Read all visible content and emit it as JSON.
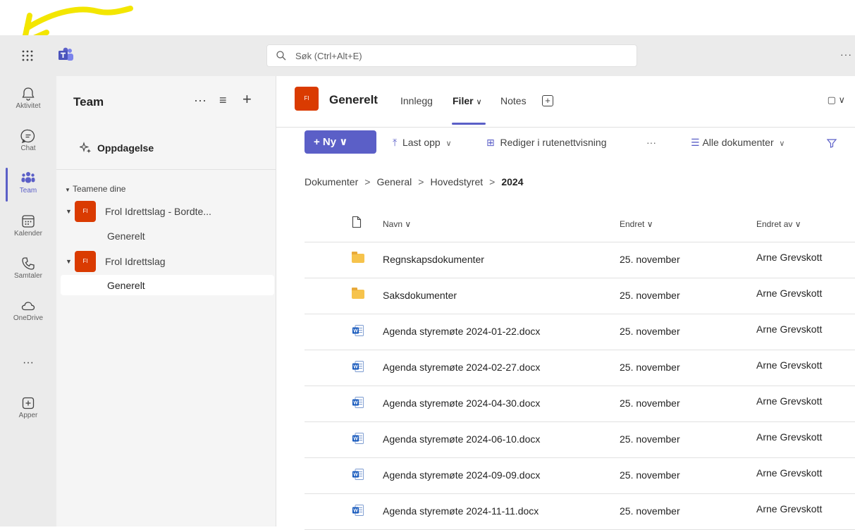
{
  "app": {
    "brand_color": "#5b5fc7",
    "annotation_color": "#f3e600"
  },
  "topbar": {
    "search_placeholder": "Søk (Ctrl+Alt+E)",
    "more": "···"
  },
  "rail": {
    "items": [
      {
        "id": "aktivitet",
        "label": "Aktivitet",
        "icon": "bell-icon"
      },
      {
        "id": "chat",
        "label": "Chat",
        "icon": "chat-icon"
      },
      {
        "id": "team",
        "label": "Team",
        "icon": "team-icon",
        "active": true
      },
      {
        "id": "kalender",
        "label": "Kalender",
        "icon": "calendar-icon"
      },
      {
        "id": "samtaler",
        "label": "Samtaler",
        "icon": "phone-icon"
      },
      {
        "id": "onedrive",
        "label": "OneDrive",
        "icon": "cloud-icon"
      },
      {
        "id": "more",
        "label": "···",
        "icon": "more-icon"
      },
      {
        "id": "apper",
        "label": "Apper",
        "icon": "add-app-icon"
      }
    ]
  },
  "panel": {
    "title": "Team",
    "actions": {
      "more": "···",
      "filter": "≡",
      "add": "+"
    },
    "discover": "Oppdagelse",
    "section": "Teamene dine",
    "teams": [
      {
        "initials": "FI",
        "name": "Frol Idrettslag - Bordte...",
        "channels": [
          "Generelt"
        ]
      },
      {
        "initials": "FI",
        "name": "Frol Idrettslag",
        "channels": [
          "Generelt"
        ]
      }
    ]
  },
  "channel": {
    "initials": "FI",
    "title": "Generelt",
    "tabs": [
      {
        "label": "Innlegg"
      },
      {
        "label": "Filer",
        "active": true,
        "chevron": "∨"
      },
      {
        "label": "Notes"
      }
    ],
    "add_tab": "+",
    "meet": "▢ ∨"
  },
  "toolbar": {
    "new": "+ Ny ∨",
    "upload": "Last opp",
    "grid": "Rediger i rutenettvisning",
    "more": "···",
    "view": "Alle dokumenter",
    "chevron": "∨"
  },
  "breadcrumb": {
    "items": [
      "Dokumenter",
      "General",
      "Hovedstyret"
    ],
    "current": "2024",
    "sep": ">"
  },
  "files": {
    "headers": {
      "name": "Navn ∨",
      "modified": "Endret ∨",
      "modified_by": "Endret av ∨"
    },
    "rows": [
      {
        "type": "folder",
        "name": "Regnskapsdokumenter",
        "modified": "25. november",
        "modified_by": "Arne Grevskott"
      },
      {
        "type": "folder",
        "name": "Saksdokumenter",
        "modified": "25. november",
        "modified_by": "Arne Grevskott"
      },
      {
        "type": "word",
        "name": "Agenda styremøte 2024-01-22.docx",
        "modified": "25. november",
        "modified_by": "Arne Grevskott"
      },
      {
        "type": "word",
        "name": "Agenda styremøte 2024-02-27.docx",
        "modified": "25. november",
        "modified_by": "Arne Grevskott"
      },
      {
        "type": "word",
        "name": "Agenda styremøte 2024-04-30.docx",
        "modified": "25. november",
        "modified_by": "Arne Grevskott"
      },
      {
        "type": "word",
        "name": "Agenda styremøte 2024-06-10.docx",
        "modified": "25. november",
        "modified_by": "Arne Grevskott"
      },
      {
        "type": "word",
        "name": "Agenda styremøte 2024-09-09.docx",
        "modified": "25. november",
        "modified_by": "Arne Grevskott"
      },
      {
        "type": "word",
        "name": "Agenda styremøte 2024-11-11.docx",
        "modified": "25. november",
        "modified_by": "Arne Grevskott"
      }
    ]
  }
}
